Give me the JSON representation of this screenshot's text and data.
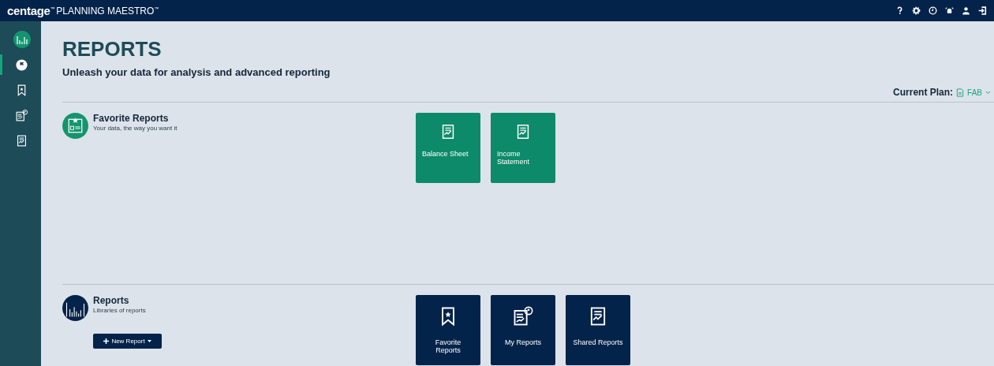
{
  "topbar": {
    "brand": "centage$^{™}$",
    "product": "PLANNING MAESTRO$^{™}$",
    "icons": [
      {
        "kind": "help"
      },
      {
        "kind": "settings"
      },
      {
        "kind": "clock"
      },
      {
        "kind": "alarm"
      },
      {
        "kind": "user"
      },
      {
        "kind": "logout"
      }
    ]
  },
  "sidebar": {
    "items": [
      {
        "kind": "logo",
        "selected": false
      },
      {
        "kind": "flag",
        "selected": true
      },
      {
        "kind": "bookmark",
        "selected": false
      },
      {
        "kind": "user-report",
        "selected": false
      },
      {
        "kind": "report",
        "selected": false
      }
    ]
  },
  "page": {
    "title": "REPORTS",
    "subtitle": "Unleash your data for analysis and advanced reporting",
    "plan_label": "Current Plan:",
    "plan_value": "FAB"
  },
  "sections": [
    {
      "kind": "favorites",
      "title": "Favorite Reports",
      "subtitle": "Your data, the way you want it",
      "tiles": [
        {
          "kind": "report",
          "label": "Balance Sheet"
        },
        {
          "kind": "report",
          "label": "Income Statement"
        }
      ]
    },
    {
      "kind": "library",
      "title": "Reports",
      "subtitle": "Libraries of reports",
      "button": "New Report",
      "tiles": [
        {
          "kind": "bookmark",
          "label": "Favorite Reports"
        },
        {
          "kind": "user-report",
          "label": "My Reports"
        },
        {
          "kind": "report",
          "label": "Shared Reports"
        }
      ]
    }
  ]
}
